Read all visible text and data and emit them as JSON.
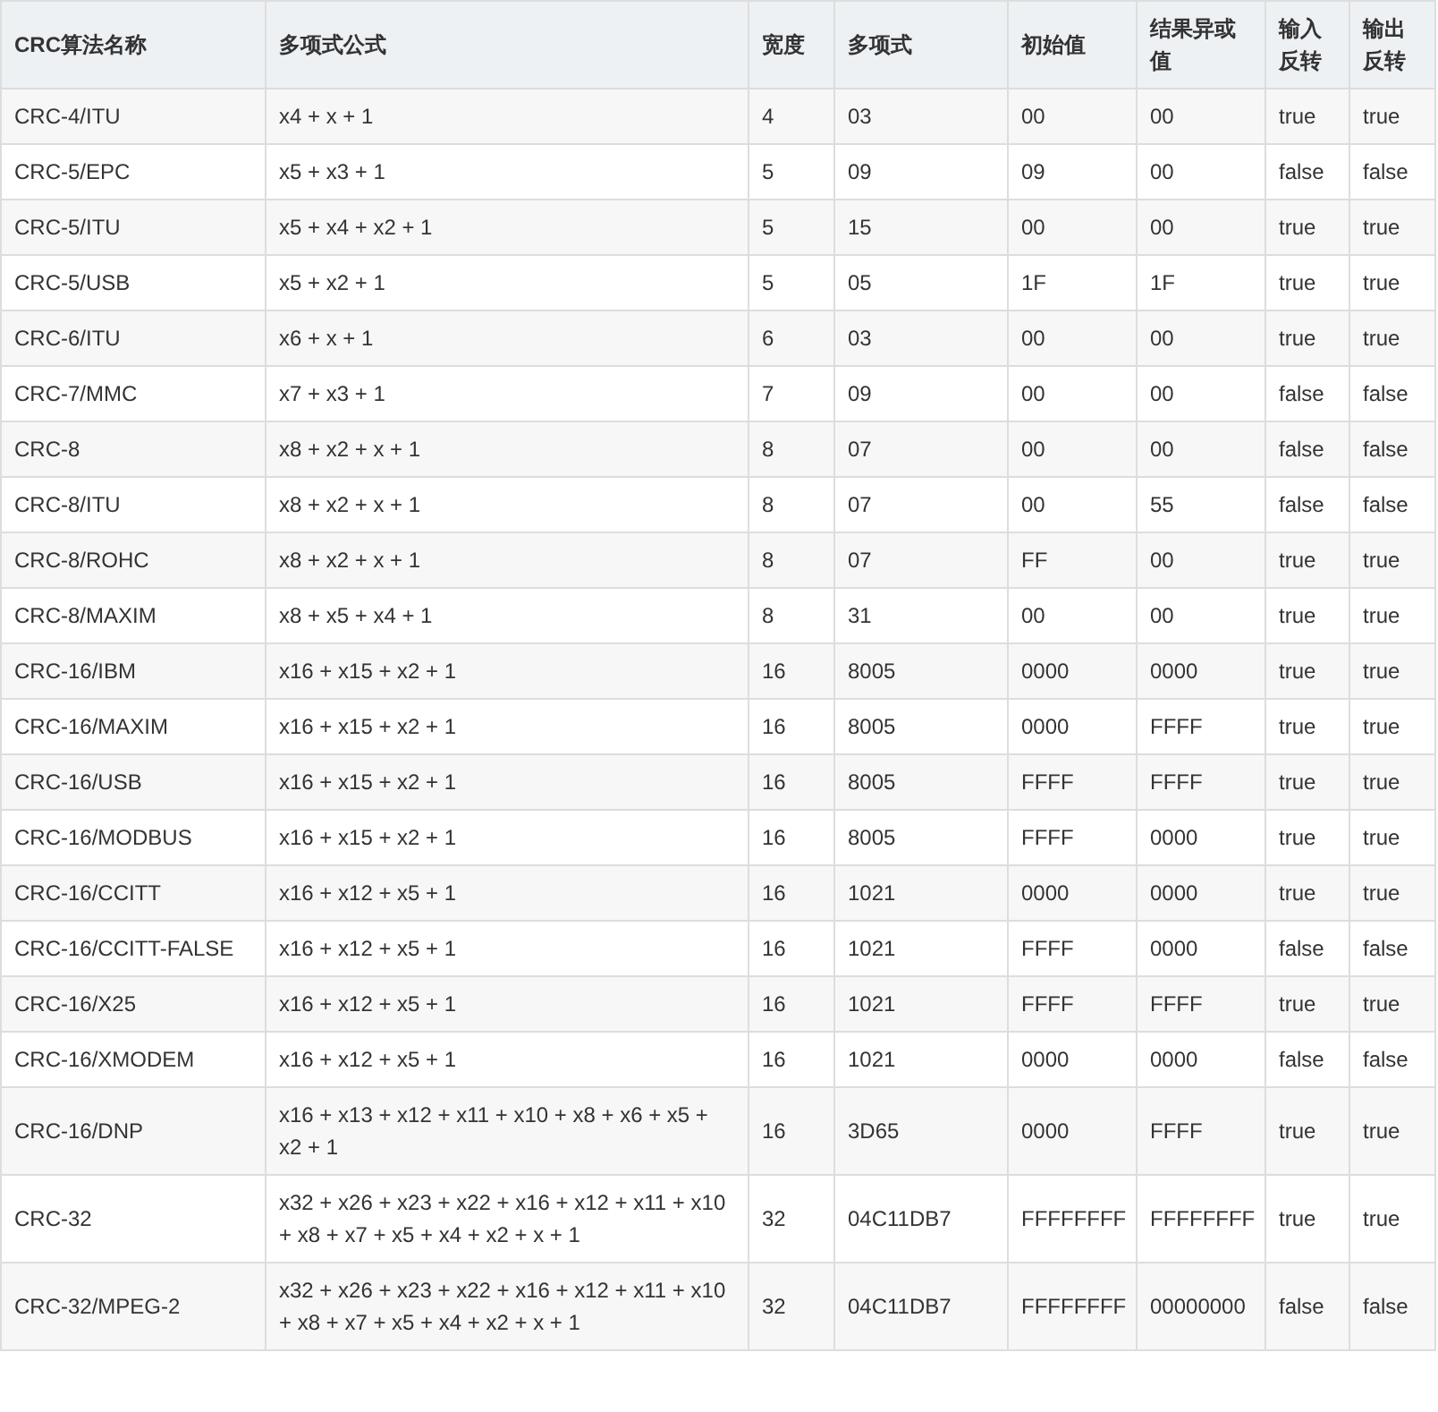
{
  "table": {
    "columns": [
      "CRC算法名称",
      "多项式公式",
      "宽度",
      "多项式",
      "初始值",
      "结果异或值",
      "输入反转",
      "输出反转"
    ],
    "rows": [
      [
        "CRC-4/ITU",
        "x4 + x + 1",
        "4",
        "03",
        "00",
        "00",
        "true",
        "true"
      ],
      [
        "CRC-5/EPC",
        "x5 + x3 + 1",
        "5",
        "09",
        "09",
        "00",
        "false",
        "false"
      ],
      [
        "CRC-5/ITU",
        "x5 + x4 + x2 + 1",
        "5",
        "15",
        "00",
        "00",
        "true",
        "true"
      ],
      [
        "CRC-5/USB",
        "x5 + x2 + 1",
        "5",
        "05",
        "1F",
        "1F",
        "true",
        "true"
      ],
      [
        "CRC-6/ITU",
        "x6 + x + 1",
        "6",
        "03",
        "00",
        "00",
        "true",
        "true"
      ],
      [
        "CRC-7/MMC",
        "x7 + x3 + 1",
        "7",
        "09",
        "00",
        "00",
        "false",
        "false"
      ],
      [
        "CRC-8",
        "x8 + x2 + x + 1",
        "8",
        "07",
        "00",
        "00",
        "false",
        "false"
      ],
      [
        "CRC-8/ITU",
        "x8 + x2 + x + 1",
        "8",
        "07",
        "00",
        "55",
        "false",
        "false"
      ],
      [
        "CRC-8/ROHC",
        "x8 + x2 + x + 1",
        "8",
        "07",
        "FF",
        "00",
        "true",
        "true"
      ],
      [
        "CRC-8/MAXIM",
        "x8 + x5 + x4 + 1",
        "8",
        "31",
        "00",
        "00",
        "true",
        "true"
      ],
      [
        "CRC-16/IBM",
        "x16 + x15 + x2 + 1",
        "16",
        "8005",
        "0000",
        "0000",
        "true",
        "true"
      ],
      [
        "CRC-16/MAXIM",
        "x16 + x15 + x2 + 1",
        "16",
        "8005",
        "0000",
        "FFFF",
        "true",
        "true"
      ],
      [
        "CRC-16/USB",
        "x16 + x15 + x2 + 1",
        "16",
        "8005",
        "FFFF",
        "FFFF",
        "true",
        "true"
      ],
      [
        "CRC-16/MODBUS",
        "x16 + x15 + x2 + 1",
        "16",
        "8005",
        "FFFF",
        "0000",
        "true",
        "true"
      ],
      [
        "CRC-16/CCITT",
        "x16 + x12 + x5 + 1",
        "16",
        "1021",
        "0000",
        "0000",
        "true",
        "true"
      ],
      [
        "CRC-16/CCITT-FALSE",
        "x16 + x12 + x5 + 1",
        "16",
        "1021",
        "FFFF",
        "0000",
        "false",
        "false"
      ],
      [
        "CRC-16/X25",
        "x16 + x12 + x5 + 1",
        "16",
        "1021",
        "FFFF",
        "FFFF",
        "true",
        "true"
      ],
      [
        "CRC-16/XMODEM",
        "x16 + x12 + x5 + 1",
        "16",
        "1021",
        "0000",
        "0000",
        "false",
        "false"
      ],
      [
        "CRC-16/DNP",
        "x16 + x13 + x12 + x11 + x10 + x8 + x6 + x5 + x2 + 1",
        "16",
        "3D65",
        "0000",
        "FFFF",
        "true",
        "true"
      ],
      [
        "CRC-32",
        "x32 + x26 + x23 + x22 + x16 + x12 + x11 + x10 + x8 + x7 + x5 + x4 + x2 + x + 1",
        "32",
        "04C11DB7",
        "FFFFFFFF",
        "FFFFFFFF",
        "true",
        "true"
      ],
      [
        "CRC-32/MPEG-2",
        "x32 + x26 + x23 + x22 + x16 + x12 + x11 + x10 + x8 + x7 + x5 + x4 + x2 + x + 1",
        "32",
        "04C11DB7",
        "FFFFFFFF",
        "00000000",
        "false",
        "false"
      ]
    ]
  }
}
